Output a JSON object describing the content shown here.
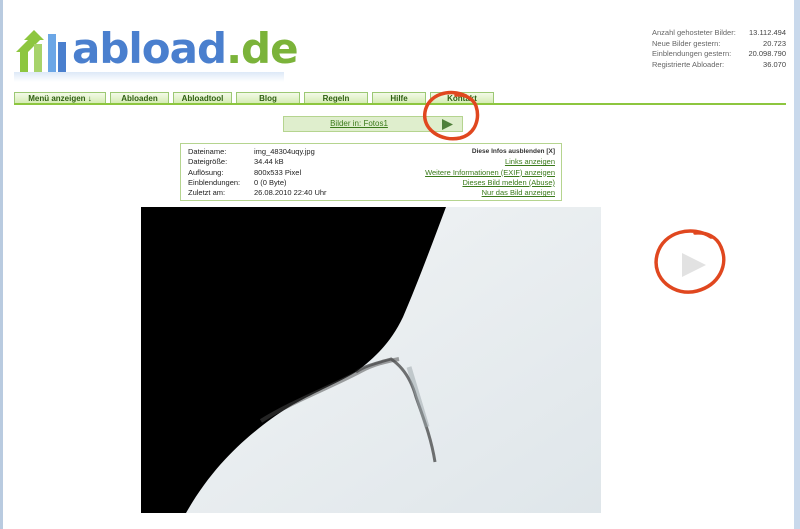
{
  "logo": {
    "main": "abload",
    "tld": ".de"
  },
  "stats": [
    {
      "label": "Anzahl gehosteter Bilder:",
      "value": "13.112.494"
    },
    {
      "label": "Neue Bilder gestern:",
      "value": "20.723"
    },
    {
      "label": "Einblendungen gestern:",
      "value": "20.098.790"
    },
    {
      "label": "Registrierte Abloader:",
      "value": "36.070"
    }
  ],
  "nav": {
    "tabs": [
      "Menü anzeigen ↓",
      "Abloaden",
      "Abloadtool",
      "Blog",
      "Regeln",
      "Hilfe",
      "Kontakt"
    ]
  },
  "album": {
    "label": "Bilder in: Fotos1"
  },
  "info": {
    "labels": [
      "Dateiname:",
      "Dateigröße:",
      "Auflösung:",
      "Einblendungen:",
      "Zuletzt am:"
    ],
    "values": [
      "img_48304uqy.jpg",
      "34.44 kB",
      "800x533 Pixel",
      "0 (0 Byte)",
      "26.08.2010 22:40 Uhr"
    ],
    "hide_label": "Diese Infos ausblenden [X]",
    "links": [
      "Links anzeigen",
      "Weitere Informationen (EXIF) anzeigen",
      "Dieses Bild melden (Abuse)",
      "Nur das Bild anzeigen"
    ]
  },
  "colors": {
    "accent_green": "#8dc63f",
    "link_green": "#3a7a1a",
    "logo_blue": "#4a7fce",
    "annotation_red": "#e0471f"
  }
}
